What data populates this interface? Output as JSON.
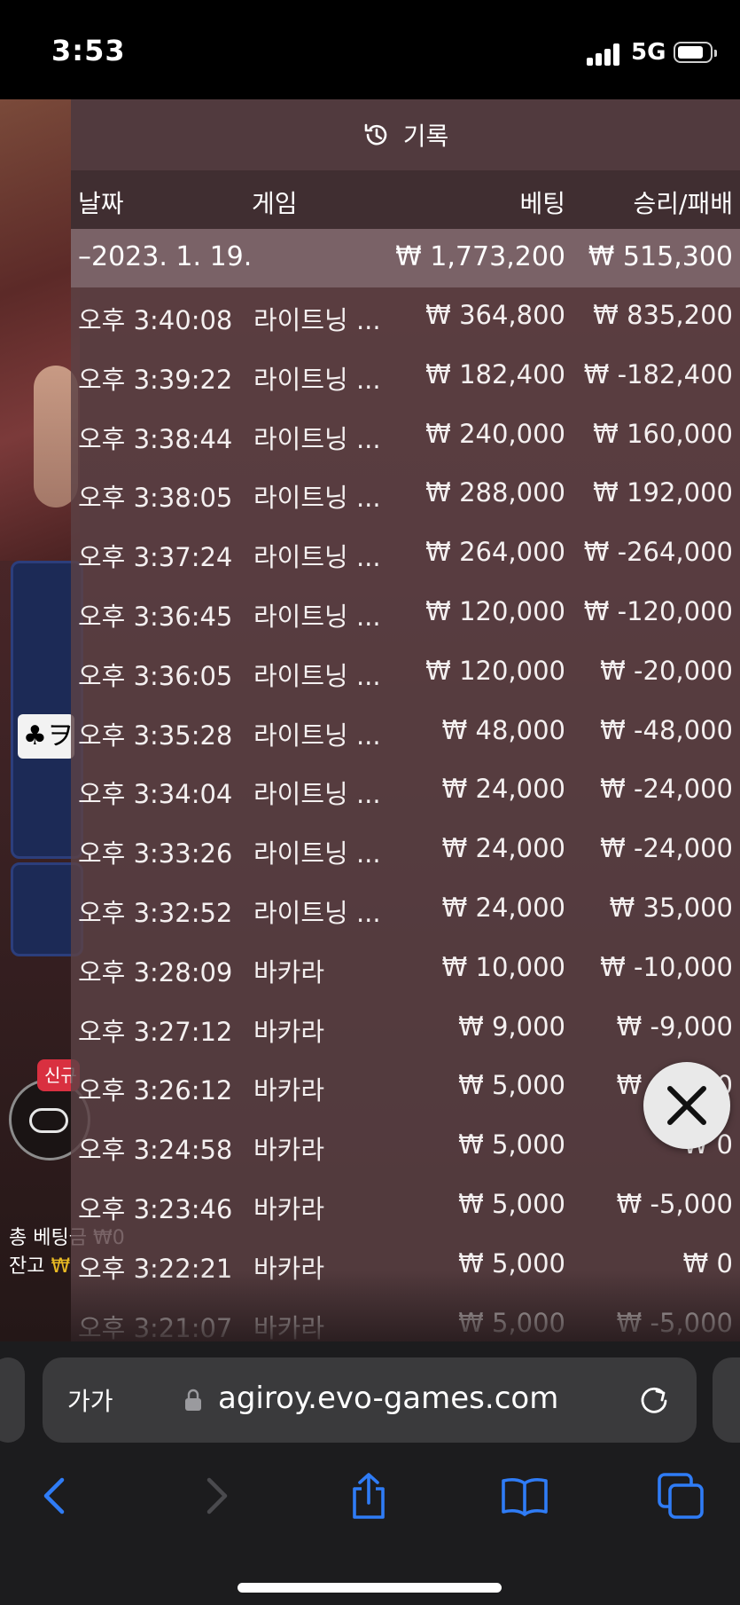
{
  "status_bar": {
    "time": "3:53",
    "network": "5G"
  },
  "background": {
    "card_label": "♣ヲ",
    "new_badge": "신규",
    "total_bet_label": "총 베팅금",
    "total_bet_value": "₩0",
    "balance_label": "잔고",
    "balance_value": "₩"
  },
  "history": {
    "title": "기록",
    "icon": "history-clock-icon",
    "columns": {
      "date": "날짜",
      "game": "게임",
      "bet": "베팅",
      "win_loss": "승리/패배"
    },
    "date_group": {
      "label": "–2023. 1. 19.",
      "bet_total": "₩ 1,773,200",
      "win_total": "₩ 515,300"
    },
    "rows": [
      {
        "time": "오후 3:40:08",
        "game": "라이트닝 ...",
        "bet": "₩ 364,800",
        "win": "₩ 835,200"
      },
      {
        "time": "오후 3:39:22",
        "game": "라이트닝 ...",
        "bet": "₩ 182,400",
        "win": "₩ -182,400"
      },
      {
        "time": "오후 3:38:44",
        "game": "라이트닝 ...",
        "bet": "₩ 240,000",
        "win": "₩ 160,000"
      },
      {
        "time": "오후 3:38:05",
        "game": "라이트닝 ...",
        "bet": "₩ 288,000",
        "win": "₩ 192,000"
      },
      {
        "time": "오후 3:37:24",
        "game": "라이트닝 ...",
        "bet": "₩ 264,000",
        "win": "₩ -264,000"
      },
      {
        "time": "오후 3:36:45",
        "game": "라이트닝 ...",
        "bet": "₩ 120,000",
        "win": "₩ -120,000"
      },
      {
        "time": "오후 3:36:05",
        "game": "라이트닝 ...",
        "bet": "₩ 120,000",
        "win": "₩ -20,000"
      },
      {
        "time": "오후 3:35:28",
        "game": "라이트닝 ...",
        "bet": "₩ 48,000",
        "win": "₩ -48,000"
      },
      {
        "time": "오후 3:34:04",
        "game": "라이트닝 ...",
        "bet": "₩ 24,000",
        "win": "₩ -24,000"
      },
      {
        "time": "오후 3:33:26",
        "game": "라이트닝 ...",
        "bet": "₩ 24,000",
        "win": "₩ -24,000"
      },
      {
        "time": "오후 3:32:52",
        "game": "라이트닝 ...",
        "bet": "₩ 24,000",
        "win": "₩ 35,000"
      },
      {
        "time": "오후 3:28:09",
        "game": "바카라",
        "bet": "₩ 10,000",
        "win": "₩ -10,000"
      },
      {
        "time": "오후 3:27:12",
        "game": "바카라",
        "bet": "₩ 9,000",
        "win": "₩ -9,000"
      },
      {
        "time": "오후 3:26:12",
        "game": "바카라",
        "bet": "₩ 5,000",
        "win": "₩ -5,000"
      },
      {
        "time": "오후 3:24:58",
        "game": "바카라",
        "bet": "₩ 5,000",
        "win": "₩ 0"
      },
      {
        "time": "오후 3:23:46",
        "game": "바카라",
        "bet": "₩ 5,000",
        "win": "₩ -5,000"
      },
      {
        "time": "오후 3:22:21",
        "game": "바카라",
        "bet": "₩ 5,000",
        "win": "₩ 0"
      },
      {
        "time": "오후 3:21:07",
        "game": "바카라",
        "bet": "₩ 5,000",
        "win": "₩ -5,000"
      }
    ]
  },
  "browser": {
    "text_size_label": "가가",
    "url": "agiroy.evo-games.com",
    "toolbar_icons": [
      "back-icon",
      "forward-icon",
      "share-icon",
      "bookmarks-icon",
      "tabs-icon"
    ]
  }
}
